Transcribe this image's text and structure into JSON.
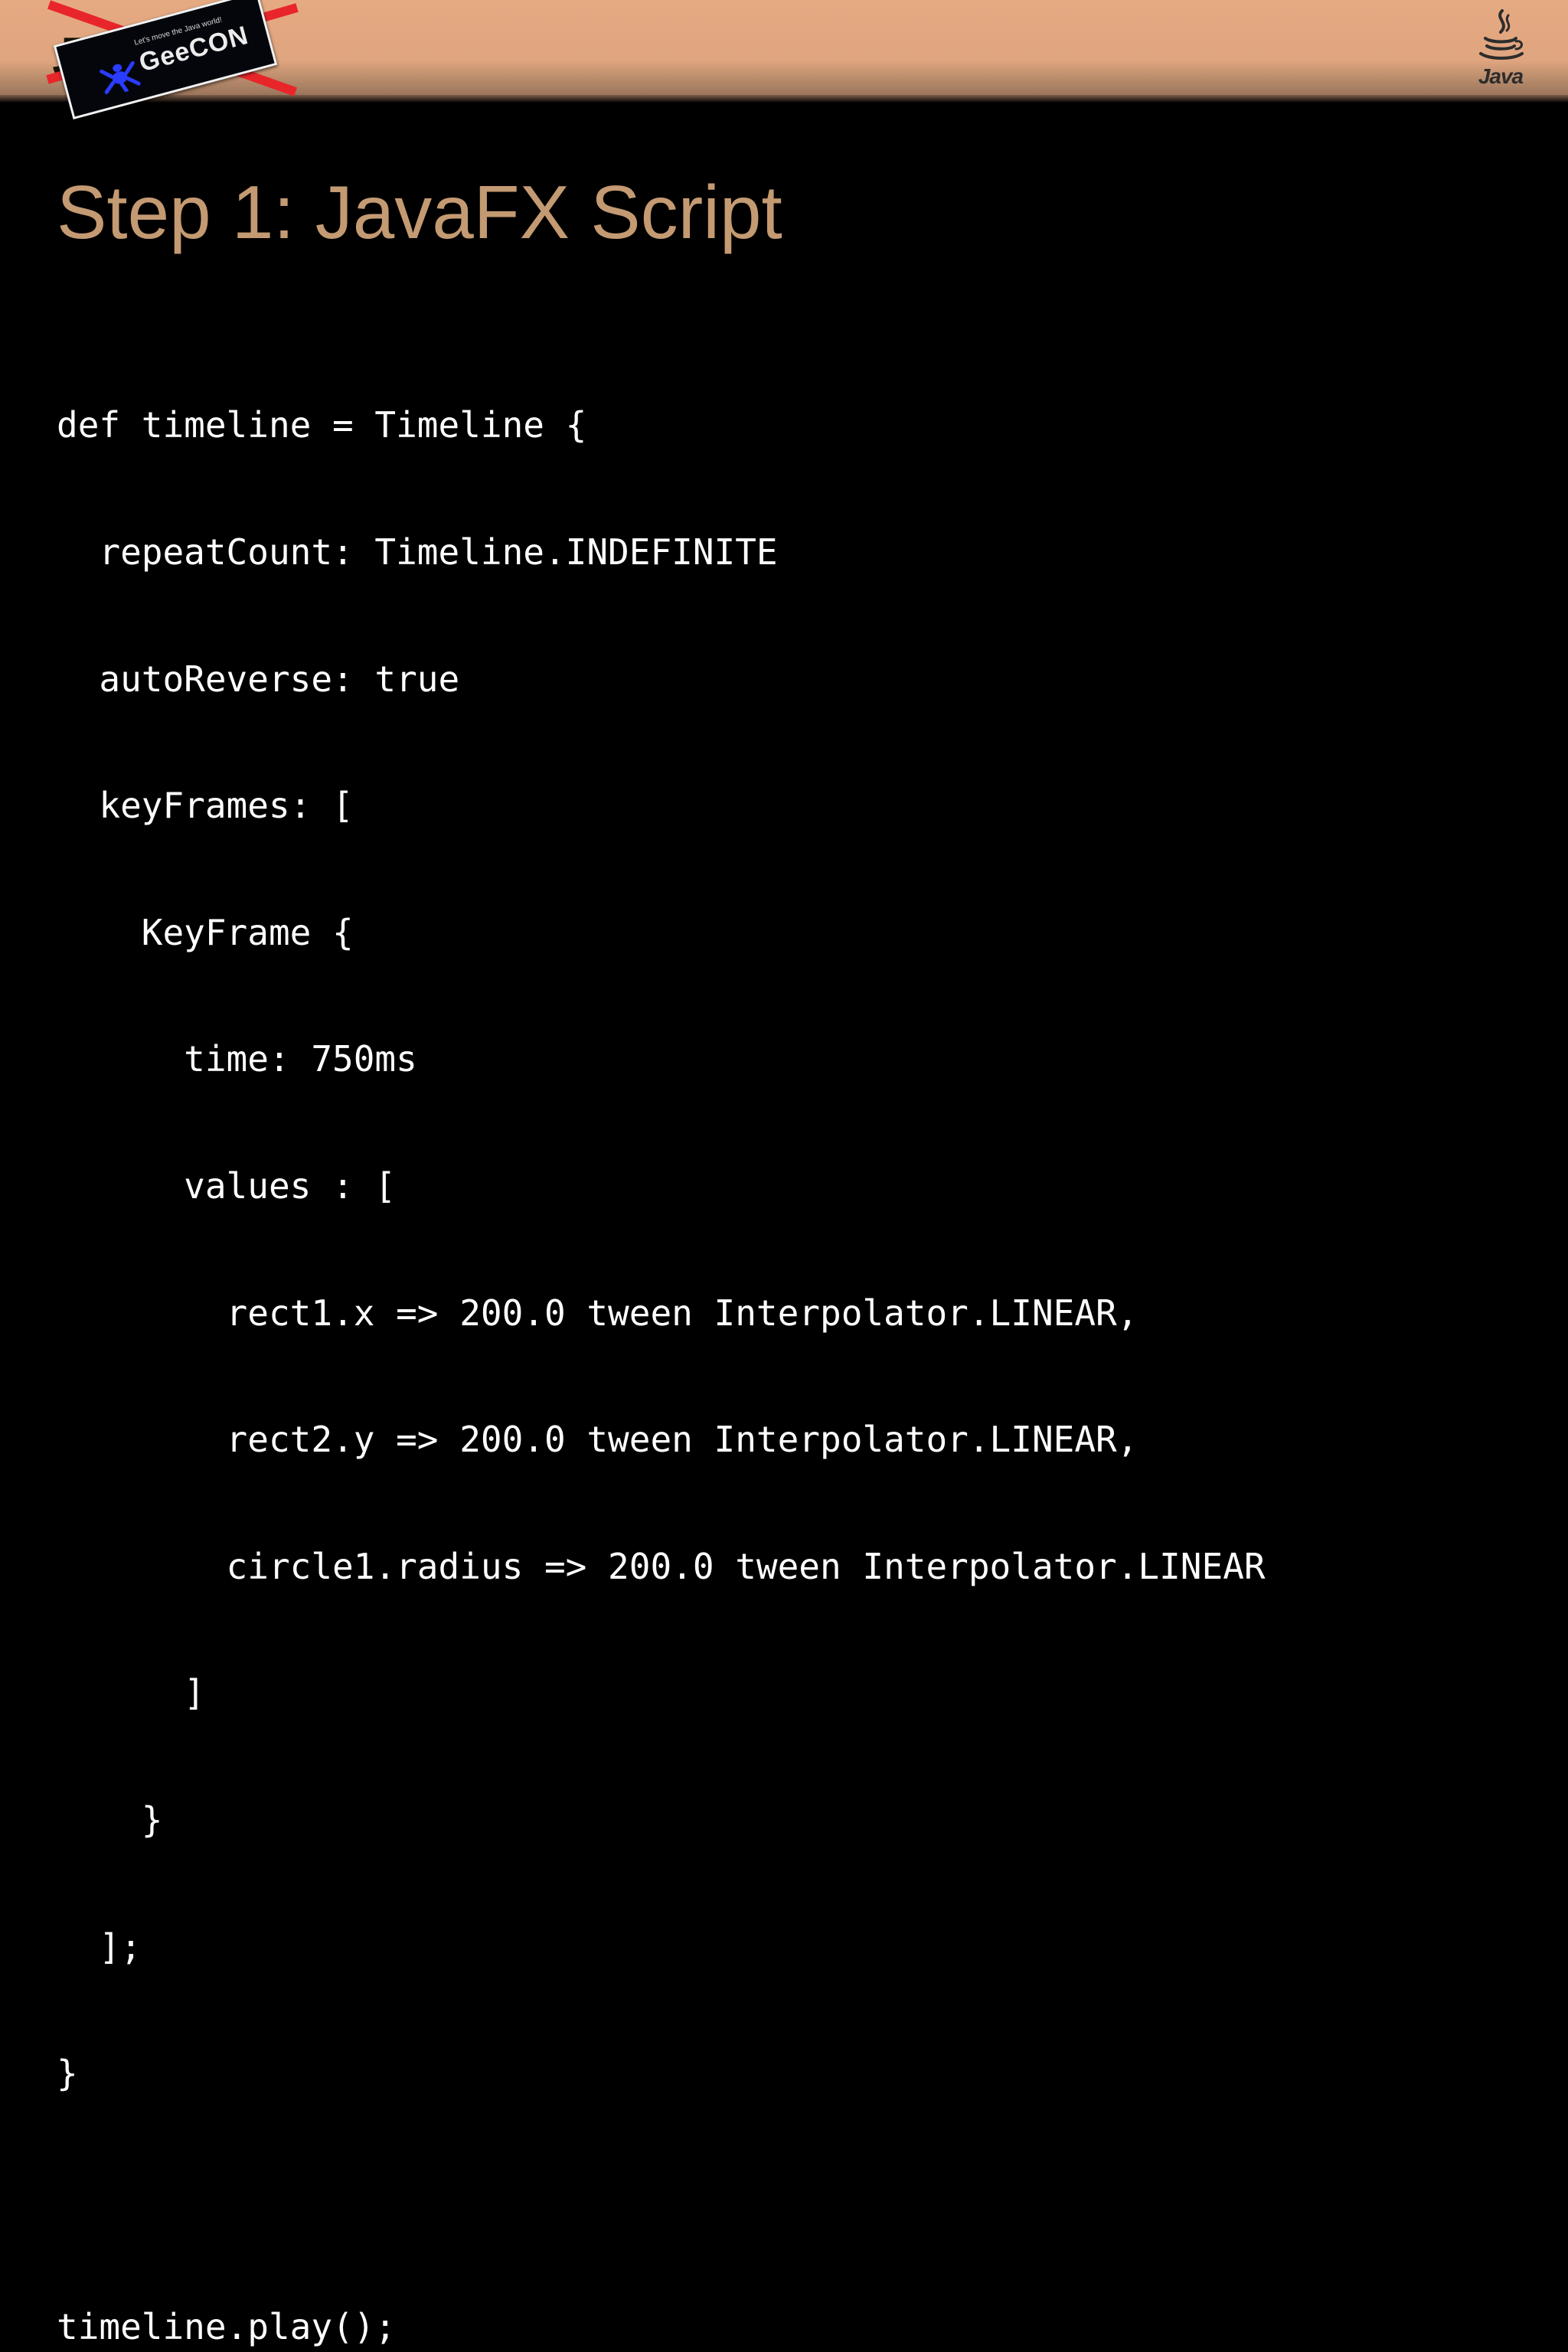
{
  "header": {
    "event_logo": {
      "tagline": "Let's move the Java world!",
      "name": "GeeCON"
    },
    "java_logo": {
      "word": "Java"
    },
    "colors": {
      "band": "#e6aa82",
      "cross_out": "#e8262a",
      "logo_mark": "#2a3cff"
    }
  },
  "slide": {
    "title": "Step 1: JavaFX Script",
    "title_color": "#c49a72",
    "code_lines": [
      "def timeline = Timeline {",
      "  repeatCount: Timeline.INDEFINITE",
      "  autoReverse: true",
      "  keyFrames: [",
      "    KeyFrame {",
      "      time: 750ms",
      "      values : [",
      "        rect1.x => 200.0 tween Interpolator.LINEAR,",
      "        rect2.y => 200.0 tween Interpolator.LINEAR,",
      "        circle1.radius => 200.0 tween Interpolator.LINEAR",
      "      ]",
      "    }",
      "  ];",
      "}",
      "",
      "timeline.play();"
    ]
  }
}
